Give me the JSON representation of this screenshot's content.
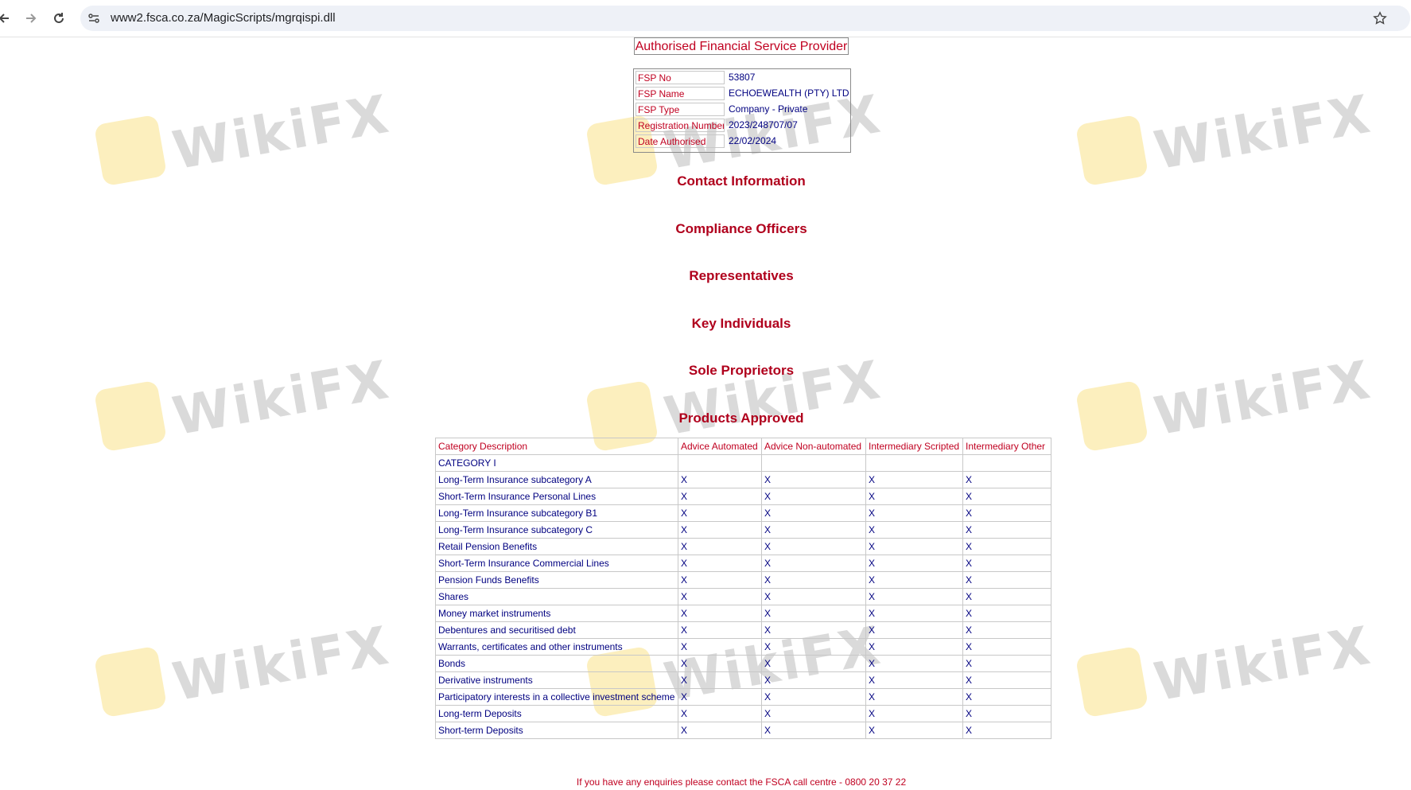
{
  "browser": {
    "url": "www2.fsca.co.za/MagicScripts/mgrqispi.dll"
  },
  "watermark": {
    "text": "WikiFX"
  },
  "page": {
    "title": "Authorised Financial Service Provider",
    "fsp": [
      {
        "label": "FSP No",
        "value": "53807"
      },
      {
        "label": "FSP Name",
        "value": "ECHOEWEALTH (PTY) LTD"
      },
      {
        "label": "FSP Type",
        "value": "Company - Private"
      },
      {
        "label": "Registration Number",
        "value": "2023/248707/07"
      },
      {
        "label": "Date Authorised",
        "value": "22/02/2024"
      }
    ],
    "sections": [
      "Contact Information",
      "Compliance Officers",
      "Representatives",
      "Key Individuals",
      "Sole Proprietors",
      "Products Approved"
    ],
    "products": {
      "headers": [
        "Category Description",
        "Advice Automated",
        "Advice Non-automated",
        "Intermediary Scripted",
        "Intermediary Other"
      ],
      "category": "CATEGORY I",
      "rows": [
        [
          "Long-Term Insurance subcategory A",
          "X",
          "X",
          "X",
          "X"
        ],
        [
          "Short-Term Insurance Personal Lines",
          "X",
          "X",
          "X",
          "X"
        ],
        [
          "Long-Term Insurance subcategory B1",
          "X",
          "X",
          "X",
          "X"
        ],
        [
          "Long-Term Insurance subcategory C",
          "X",
          "X",
          "X",
          "X"
        ],
        [
          "Retail Pension Benefits",
          "X",
          "X",
          "X",
          "X"
        ],
        [
          "Short-Term Insurance Commercial Lines",
          "X",
          "X",
          "X",
          "X"
        ],
        [
          "Pension Funds Benefits",
          "X",
          "X",
          "X",
          "X"
        ],
        [
          "Shares",
          "X",
          "X",
          "X",
          "X"
        ],
        [
          "Money market instruments",
          "X",
          "X",
          "X",
          "X"
        ],
        [
          "Debentures and securitised debt",
          "X",
          "X",
          "X",
          "X"
        ],
        [
          "Warrants, certificates and other instruments",
          "X",
          "X",
          "X",
          "X"
        ],
        [
          "Bonds",
          "X",
          "X",
          "X",
          "X"
        ],
        [
          "Derivative instruments",
          "X",
          "X",
          "X",
          "X"
        ],
        [
          "Participatory interests in a collective investment scheme",
          "X",
          "X",
          "X",
          "X"
        ],
        [
          "Long-term Deposits",
          "X",
          "X",
          "X",
          "X"
        ],
        [
          "Short-term Deposits",
          "X",
          "X",
          "X",
          "X"
        ]
      ]
    },
    "enquiry": "If you have any enquiries please contact the FSCA call centre - 0800 20 37 22"
  }
}
